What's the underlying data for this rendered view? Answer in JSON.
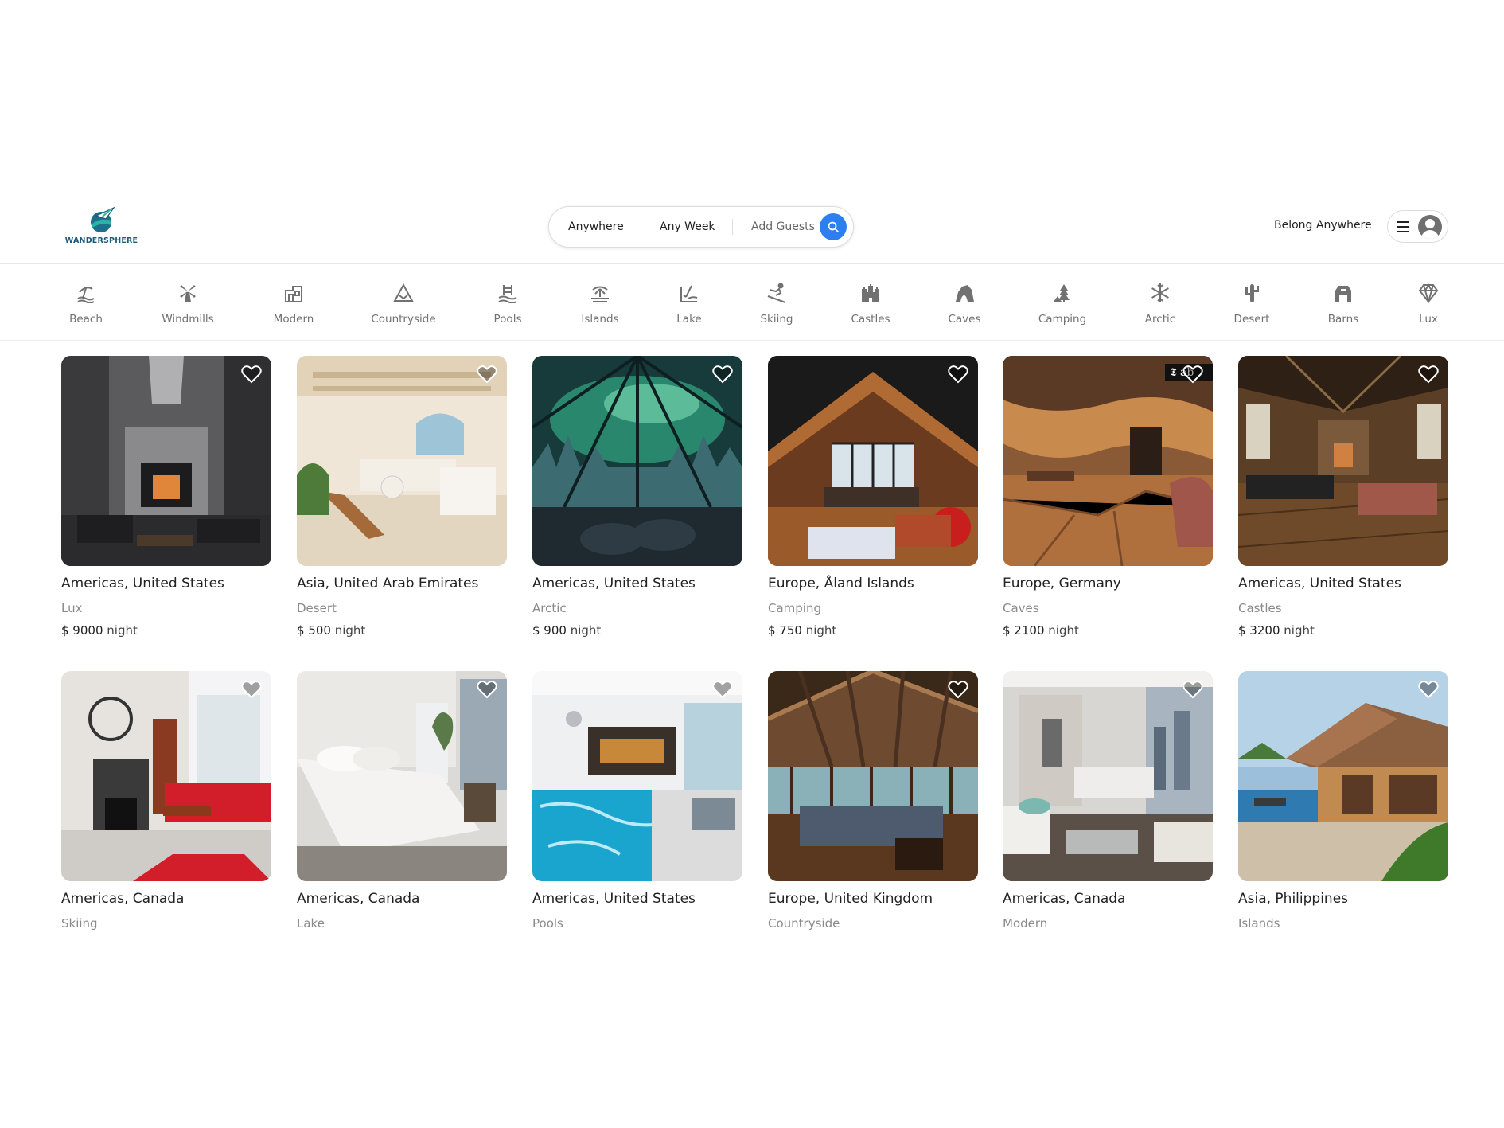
{
  "brand": {
    "name": "WANDERSPHERE"
  },
  "search": {
    "where": "Anywhere",
    "when": "Any Week",
    "guests": "Add Guests"
  },
  "header": {
    "tagline": "Belong Anywhere"
  },
  "colors": {
    "accent": "#2d7ff0",
    "brand": "#1a5a7a",
    "text": "#222222",
    "muted": "#8a8a8a"
  },
  "categories": [
    {
      "label": "Beach",
      "icon": "beach-icon"
    },
    {
      "label": "Windmills",
      "icon": "windmill-icon"
    },
    {
      "label": "Modern",
      "icon": "modern-house-icon"
    },
    {
      "label": "Countryside",
      "icon": "mountain-icon"
    },
    {
      "label": "Pools",
      "icon": "pool-icon"
    },
    {
      "label": "Islands",
      "icon": "island-icon"
    },
    {
      "label": "Lake",
      "icon": "lake-icon"
    },
    {
      "label": "Skiing",
      "icon": "skiing-icon"
    },
    {
      "label": "Castles",
      "icon": "castle-icon"
    },
    {
      "label": "Caves",
      "icon": "cave-icon"
    },
    {
      "label": "Camping",
      "icon": "camping-icon"
    },
    {
      "label": "Arctic",
      "icon": "snowflake-icon"
    },
    {
      "label": "Desert",
      "icon": "cactus-icon"
    },
    {
      "label": "Barns",
      "icon": "barn-icon"
    },
    {
      "label": "Lux",
      "icon": "diamond-icon"
    }
  ],
  "listings": [
    {
      "location": "Americas, United States",
      "type": "Lux",
      "price": "$ 9000",
      "unit": "night"
    },
    {
      "location": "Asia, United Arab Emirates",
      "type": "Desert",
      "price": "$ 500",
      "unit": "night"
    },
    {
      "location": "Americas, United States",
      "type": "Arctic",
      "price": "$ 900",
      "unit": "night"
    },
    {
      "location": "Europe, Åland Islands",
      "type": "Camping",
      "price": "$ 750",
      "unit": "night"
    },
    {
      "location": "Europe, Germany",
      "type": "Caves",
      "price": "$ 2100",
      "unit": "night",
      "badge": "𝕿 ab"
    },
    {
      "location": "Americas, United States",
      "type": "Castles",
      "price": "$ 3200",
      "unit": "night"
    },
    {
      "location": "Americas, Canada",
      "type": "Skiing"
    },
    {
      "location": "Americas, Canada",
      "type": "Lake"
    },
    {
      "location": "Americas, United States",
      "type": "Pools"
    },
    {
      "location": "Europe, United Kingdom",
      "type": "Countryside"
    },
    {
      "location": "Americas, Canada",
      "type": "Modern"
    },
    {
      "location": "Asia, Philippines",
      "type": "Islands"
    }
  ]
}
